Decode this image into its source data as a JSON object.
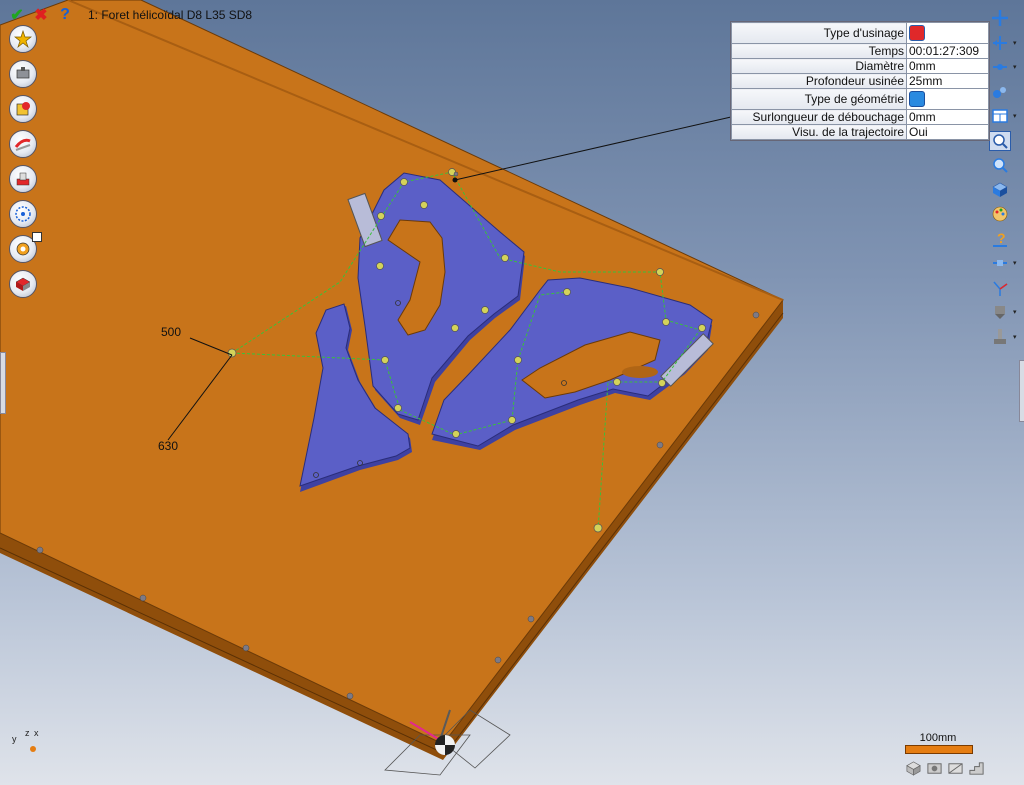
{
  "toolbar": {
    "validate_icon": "check-icon",
    "cancel_icon": "close-icon",
    "help_icon": "help-icon",
    "operation_title": "1: Foret hélicoïdal D8 L35 SD8"
  },
  "left_tools": [
    {
      "name": "star-tool-icon"
    },
    {
      "name": "drill-tool-icon"
    },
    {
      "name": "cube-tool-icon"
    },
    {
      "name": "contour-tool-icon"
    },
    {
      "name": "pocket-tool-icon"
    },
    {
      "name": "path-tool-icon"
    },
    {
      "name": "gear-tool-icon"
    },
    {
      "name": "simulation-tool-icon"
    }
  ],
  "properties": {
    "rows": [
      {
        "label": "Type d'usinage",
        "value": "",
        "icon": "drill-type-icon",
        "icon_color": "#e0282a"
      },
      {
        "label": "Temps",
        "value": "00:01:27:309"
      },
      {
        "label": "Diamètre",
        "value": "0mm"
      },
      {
        "label": "Profondeur usinée",
        "value": "25mm"
      },
      {
        "label": "Type de géométrie",
        "value": "",
        "icon": "geometry-type-icon",
        "icon_color": "#2a8ae0"
      },
      {
        "label": "Surlongueur de débouchage",
        "value": "0mm"
      },
      {
        "label": "Visu. de la trajectoire",
        "value": "Oui"
      }
    ]
  },
  "dimensions": {
    "d1": "500",
    "d2": "630"
  },
  "scale": {
    "label": "100mm"
  },
  "axis_labels": {
    "y": "y",
    "z": "z",
    "x": "x"
  },
  "colors": {
    "board": "#c8741a",
    "board_edge": "#8f4e0b",
    "parts": "#5b5fc7",
    "toolpath": "#39c23a",
    "accent_orange": "#e57d12"
  }
}
